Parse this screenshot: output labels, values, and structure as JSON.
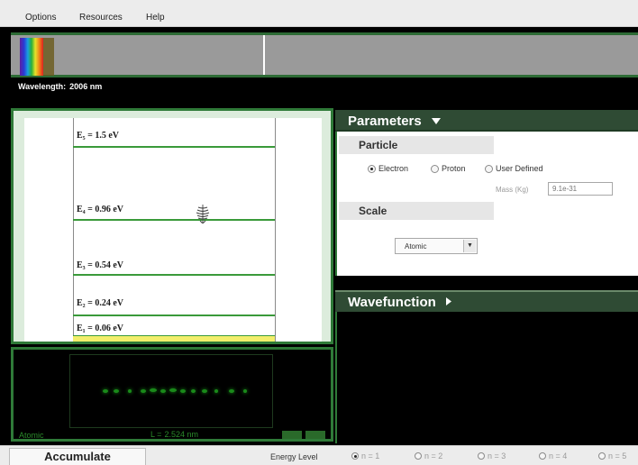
{
  "menu": {
    "items": [
      "Options",
      "Resources",
      "Help"
    ]
  },
  "spectrum": {
    "wavelength_label": "Wavelength:",
    "wavelength_value": "2006 nm"
  },
  "energy_levels": [
    {
      "label": "E₅ = 1.5 eV"
    },
    {
      "label": "E₄ = 0.96 eV"
    },
    {
      "label": "E₃ = 0.54 eV"
    },
    {
      "label": "E₂ = 0.24 eV"
    },
    {
      "label": "E₁ = 0.06 eV"
    }
  ],
  "screen": {
    "scale_label": "Atomic",
    "length_label": "L =",
    "length_value": "2.524 nm"
  },
  "parameters": {
    "title": "Parameters",
    "particle_section": "Particle",
    "particle_options": [
      "Electron",
      "Proton",
      "User Defined"
    ],
    "particle_selected": "Electron",
    "mass_label": "Mass (Kg)",
    "mass_value": "9.1e-31",
    "scale_section": "Scale",
    "scale_value": "Atomic"
  },
  "wavefunction": {
    "title": "Wavefunction"
  },
  "bottom": {
    "accumulate_label": "Accumulate",
    "energy_level_label": "Energy Level",
    "levels": [
      "n = 1",
      "n = 2",
      "n = 3",
      "n = 4",
      "n = 5"
    ],
    "selected_level": "n = 1"
  },
  "colors": {
    "panel_green": "#2f7a38",
    "header_dark": "#2f4b34",
    "level_line": "#3a9a3a",
    "ground_band": "#f2ee6a",
    "screen_dots": "#1a8a1a"
  },
  "icons": {
    "photon": "photon-wave-icon",
    "dropdown": "chevron-down-icon",
    "expand": "chevron-right-icon"
  }
}
